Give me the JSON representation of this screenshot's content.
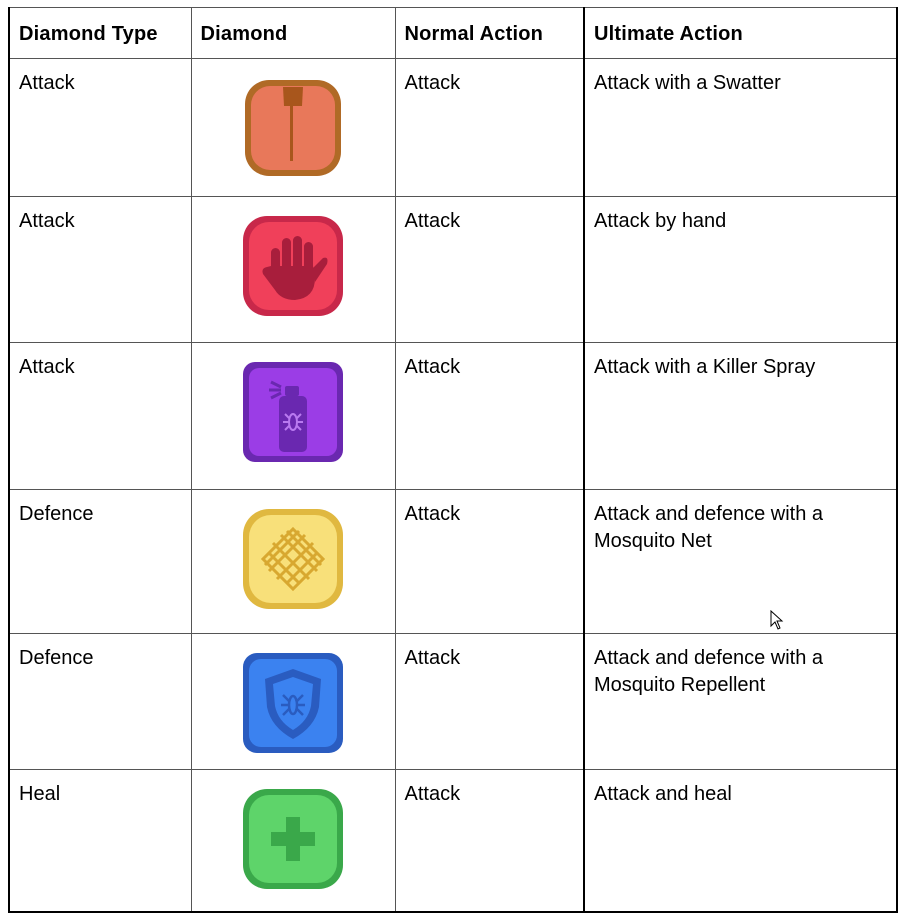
{
  "table": {
    "headers": [
      "Diamond Type",
      "Diamond",
      "Normal Action",
      "Ultimate Action"
    ],
    "rows": [
      {
        "type": "Attack",
        "icon": "swatter-icon",
        "normal": "Attack",
        "ultimate": "Attack with a Swatter",
        "color": "#e8785a"
      },
      {
        "type": "Attack",
        "icon": "hand-icon",
        "normal": "Attack",
        "ultimate": "Attack by hand",
        "color": "#f0405a"
      },
      {
        "type": "Attack",
        "icon": "spray-can-icon",
        "normal": "Attack",
        "ultimate": "Attack with a Killer Spray",
        "color": "#9b3de6"
      },
      {
        "type": "Defence",
        "icon": "mosquito-net-icon",
        "normal": "Attack",
        "ultimate": "Attack and defence with a Mosquito Net",
        "color": "#f8e07a"
      },
      {
        "type": "Defence",
        "icon": "shield-icon",
        "normal": "Attack",
        "ultimate": "Attack and defence with a Mosquito Repellent",
        "color": "#3b82f0"
      },
      {
        "type": "Heal",
        "icon": "plus-icon",
        "normal": "Attack",
        "ultimate": "Attack and heal",
        "color": "#5ed46a"
      }
    ]
  }
}
